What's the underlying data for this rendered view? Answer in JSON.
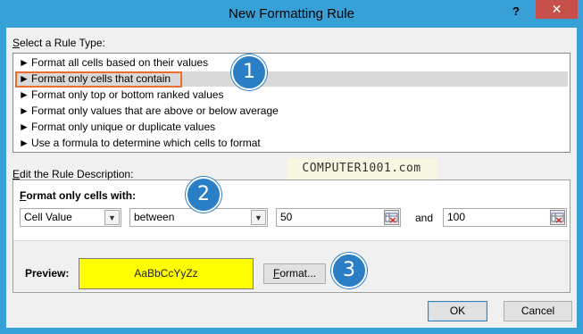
{
  "window": {
    "title": "New Formatting Rule",
    "help_label": "?",
    "close_label": "✕"
  },
  "rule_type": {
    "label_prefix": "S",
    "label_rest": "elect a Rule Type:",
    "items": [
      {
        "label": "Format all cells based on their values"
      },
      {
        "label": "Format only cells that contain",
        "selected": true
      },
      {
        "label": "Format only top or bottom ranked values"
      },
      {
        "label": "Format only values that are above or below average"
      },
      {
        "label": "Format only unique or duplicate values"
      },
      {
        "label": "Use a formula to determine which cells to format"
      }
    ],
    "item_arrow": "►"
  },
  "watermark": "COMPUTER1001.com",
  "description": {
    "label_prefix": "E",
    "label_rest": "dit the Rule Description:",
    "format_only_prefix": "F",
    "format_only_rest": "ormat only cells with:",
    "condition_type": {
      "value": "Cell Value"
    },
    "operator": {
      "value": "between"
    },
    "value1": "50",
    "and_label": "and",
    "value2": "100",
    "preview_label": "Preview:",
    "preview_sample": "AaBbCcYyZz",
    "preview_color": "#ffff00",
    "format_button_prefix": "F",
    "format_button_rest": "ormat..."
  },
  "footer": {
    "ok_label": "OK",
    "cancel_label": "Cancel"
  },
  "callouts": [
    "1",
    "2",
    "3"
  ],
  "colors": {
    "titlebar": "#37a0d6",
    "close_button": "#c7504b",
    "selection_outline": "#ec6d2c",
    "callout_badge": "#2a7ec6"
  }
}
